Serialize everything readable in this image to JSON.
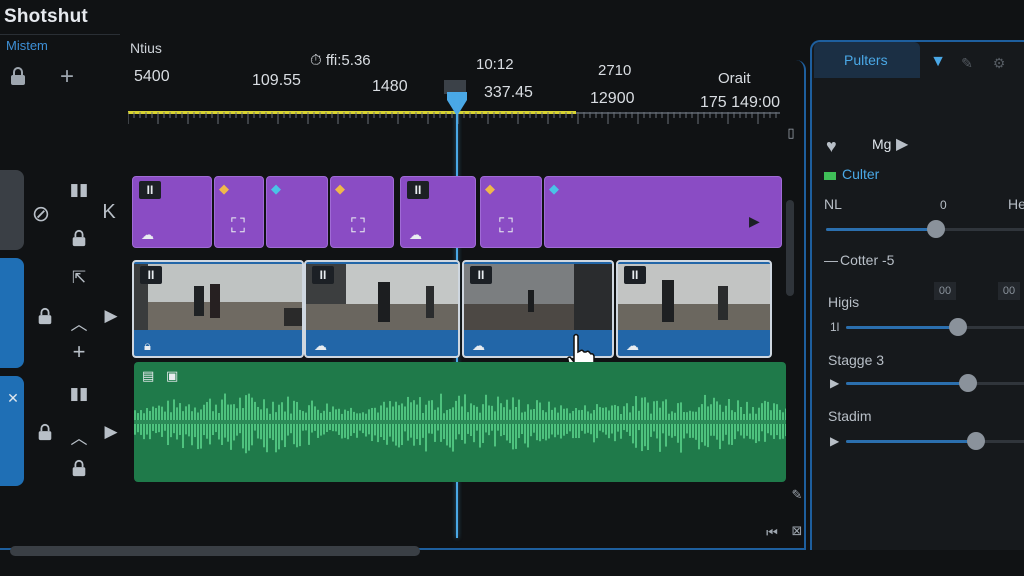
{
  "app": {
    "title": "Shotshut",
    "menu_label": "Mistem"
  },
  "timeline": {
    "column_label": "Ntius",
    "timecodes_top": [
      "⏱ ffi:5.36",
      "10:12",
      "2710",
      "Orait"
    ],
    "timecodes_bottom": [
      "5400",
      "109.55",
      "1480",
      "337.45",
      "12900",
      "175 149:00"
    ],
    "playhead_fraction": 0.5
  },
  "tracks": {
    "title_clips": [
      {
        "badge": "II"
      },
      {
        "badge": ""
      },
      {
        "badge": ""
      },
      {
        "badge": ""
      },
      {
        "badge": "II"
      },
      {
        "badge": ""
      },
      {
        "badge": ""
      }
    ],
    "video_clips": [
      {
        "badge": "II"
      },
      {
        "badge": "II"
      },
      {
        "badge": "II"
      },
      {
        "badge": "II"
      }
    ]
  },
  "panel": {
    "tab_label": "Pulters",
    "row1_label": "Mg",
    "section_title": "Culter",
    "nl_label": "NL",
    "nl_value": "0",
    "he_label": "He",
    "section2_title": "Cotter -5",
    "box_value": "00",
    "box_value2": "00",
    "highs_label": "Higis",
    "highs_sub": "1l",
    "stage_label": "Stagge 3",
    "stadim_label": "Stadim",
    "sliders": [
      {
        "name": "nl",
        "value": 0.55
      },
      {
        "name": "highs",
        "value": 0.62
      },
      {
        "name": "stage",
        "value": 0.68
      },
      {
        "name": "stadim",
        "value": 0.72
      }
    ]
  },
  "colors": {
    "accent": "#4aa8e6",
    "title_track": "#8a4cc4",
    "video_track": "#2266a8",
    "audio_track": "#1f7a4a",
    "ruler_progress": "#d8d431"
  }
}
